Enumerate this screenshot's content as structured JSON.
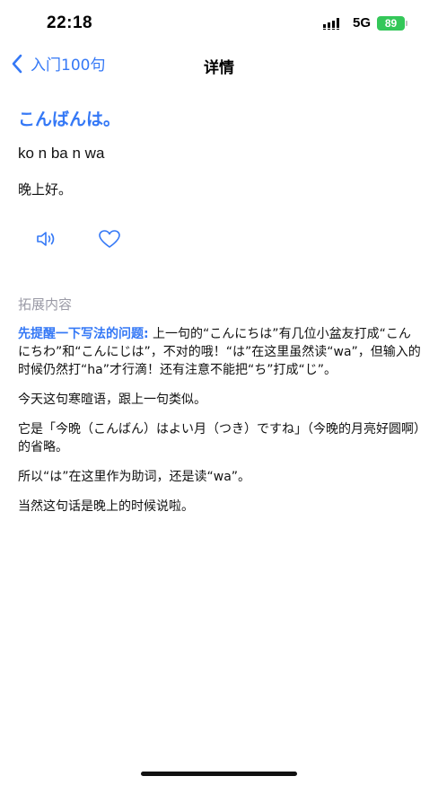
{
  "status_bar": {
    "time": "22:18",
    "network": "5G",
    "battery": "89"
  },
  "nav": {
    "back_label": "入门100句",
    "title": "详情"
  },
  "phrase": {
    "japanese": "こんばんは。",
    "romaji": "ko n ba n wa",
    "meaning": "晚上好。"
  },
  "section": {
    "title": "拓展内容"
  },
  "content": {
    "lead_highlight": "先提醒一下写法的问题:",
    "lead_text": " 上一句的“こんにちは”有几位小盆友打成“こんにちわ”和“こんにじは”，不对的哦！“は”在这里虽然读“wa”，但输入的时候仍然打“ha”才行滴！还有注意不能把“ち”打成“じ”。",
    "p2": "今天这句寒暄语，跟上一句类似。",
    "p3": "它是「今晩（こんばん）はよい月（つき）ですね」（今晚的月亮好圆啊）的省略。",
    "p4": "所以“は”在这里作为助词，还是读“wa”。",
    "p5": "当然这句话是晚上的时候说啦。"
  },
  "icons": {
    "back": "chevron-left-icon",
    "speaker": "speaker-icon",
    "favorite": "heart-icon",
    "signal": "signal-icon"
  },
  "colors": {
    "accent": "#3478f6",
    "battery": "#34c759",
    "muted": "#9a9aa6"
  }
}
